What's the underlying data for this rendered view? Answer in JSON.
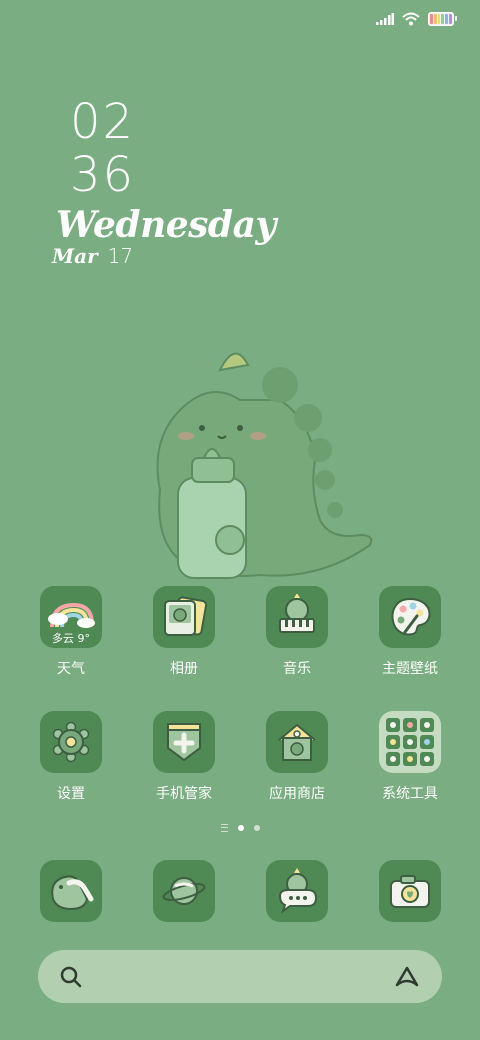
{
  "status_bar": {
    "icons": [
      "signal-icon",
      "wifi-icon",
      "battery-icon"
    ],
    "battery_colors": [
      "#f08a8a",
      "#f0c070",
      "#e8e070",
      "#90d090",
      "#80b8e8",
      "#b090e0"
    ]
  },
  "clock": {
    "hour": "02",
    "minute": "36",
    "weekday": "Wednesday",
    "month": "Mar",
    "day": "17"
  },
  "colors": {
    "background": "#7aae82",
    "tile": "#4f8a55",
    "search_bar": "#b2cfb0"
  },
  "apps_row1": [
    {
      "label": "天气",
      "icon": "weather-rainbow-icon",
      "overlay_text": "多云 9°"
    },
    {
      "label": "相册",
      "icon": "gallery-icon"
    },
    {
      "label": "音乐",
      "icon": "music-dino-piano-icon"
    },
    {
      "label": "主题壁纸",
      "icon": "theme-palette-icon"
    }
  ],
  "apps_row2": [
    {
      "label": "设置",
      "icon": "settings-gear-icon"
    },
    {
      "label": "手机管家",
      "icon": "phone-manager-shield-icon"
    },
    {
      "label": "应用商店",
      "icon": "app-store-house-icon"
    },
    {
      "label": "系统工具",
      "icon": "system-tools-folder-icon"
    }
  ],
  "dock": [
    {
      "icon": "phone-dino-icon"
    },
    {
      "icon": "browser-planet-icon"
    },
    {
      "icon": "messages-dino-bubble-icon"
    },
    {
      "icon": "camera-icon"
    }
  ],
  "pager": {
    "pages": 2,
    "active": 1
  },
  "search": {
    "left_icon": "search-icon",
    "right_icon": "assistant-icon"
  }
}
